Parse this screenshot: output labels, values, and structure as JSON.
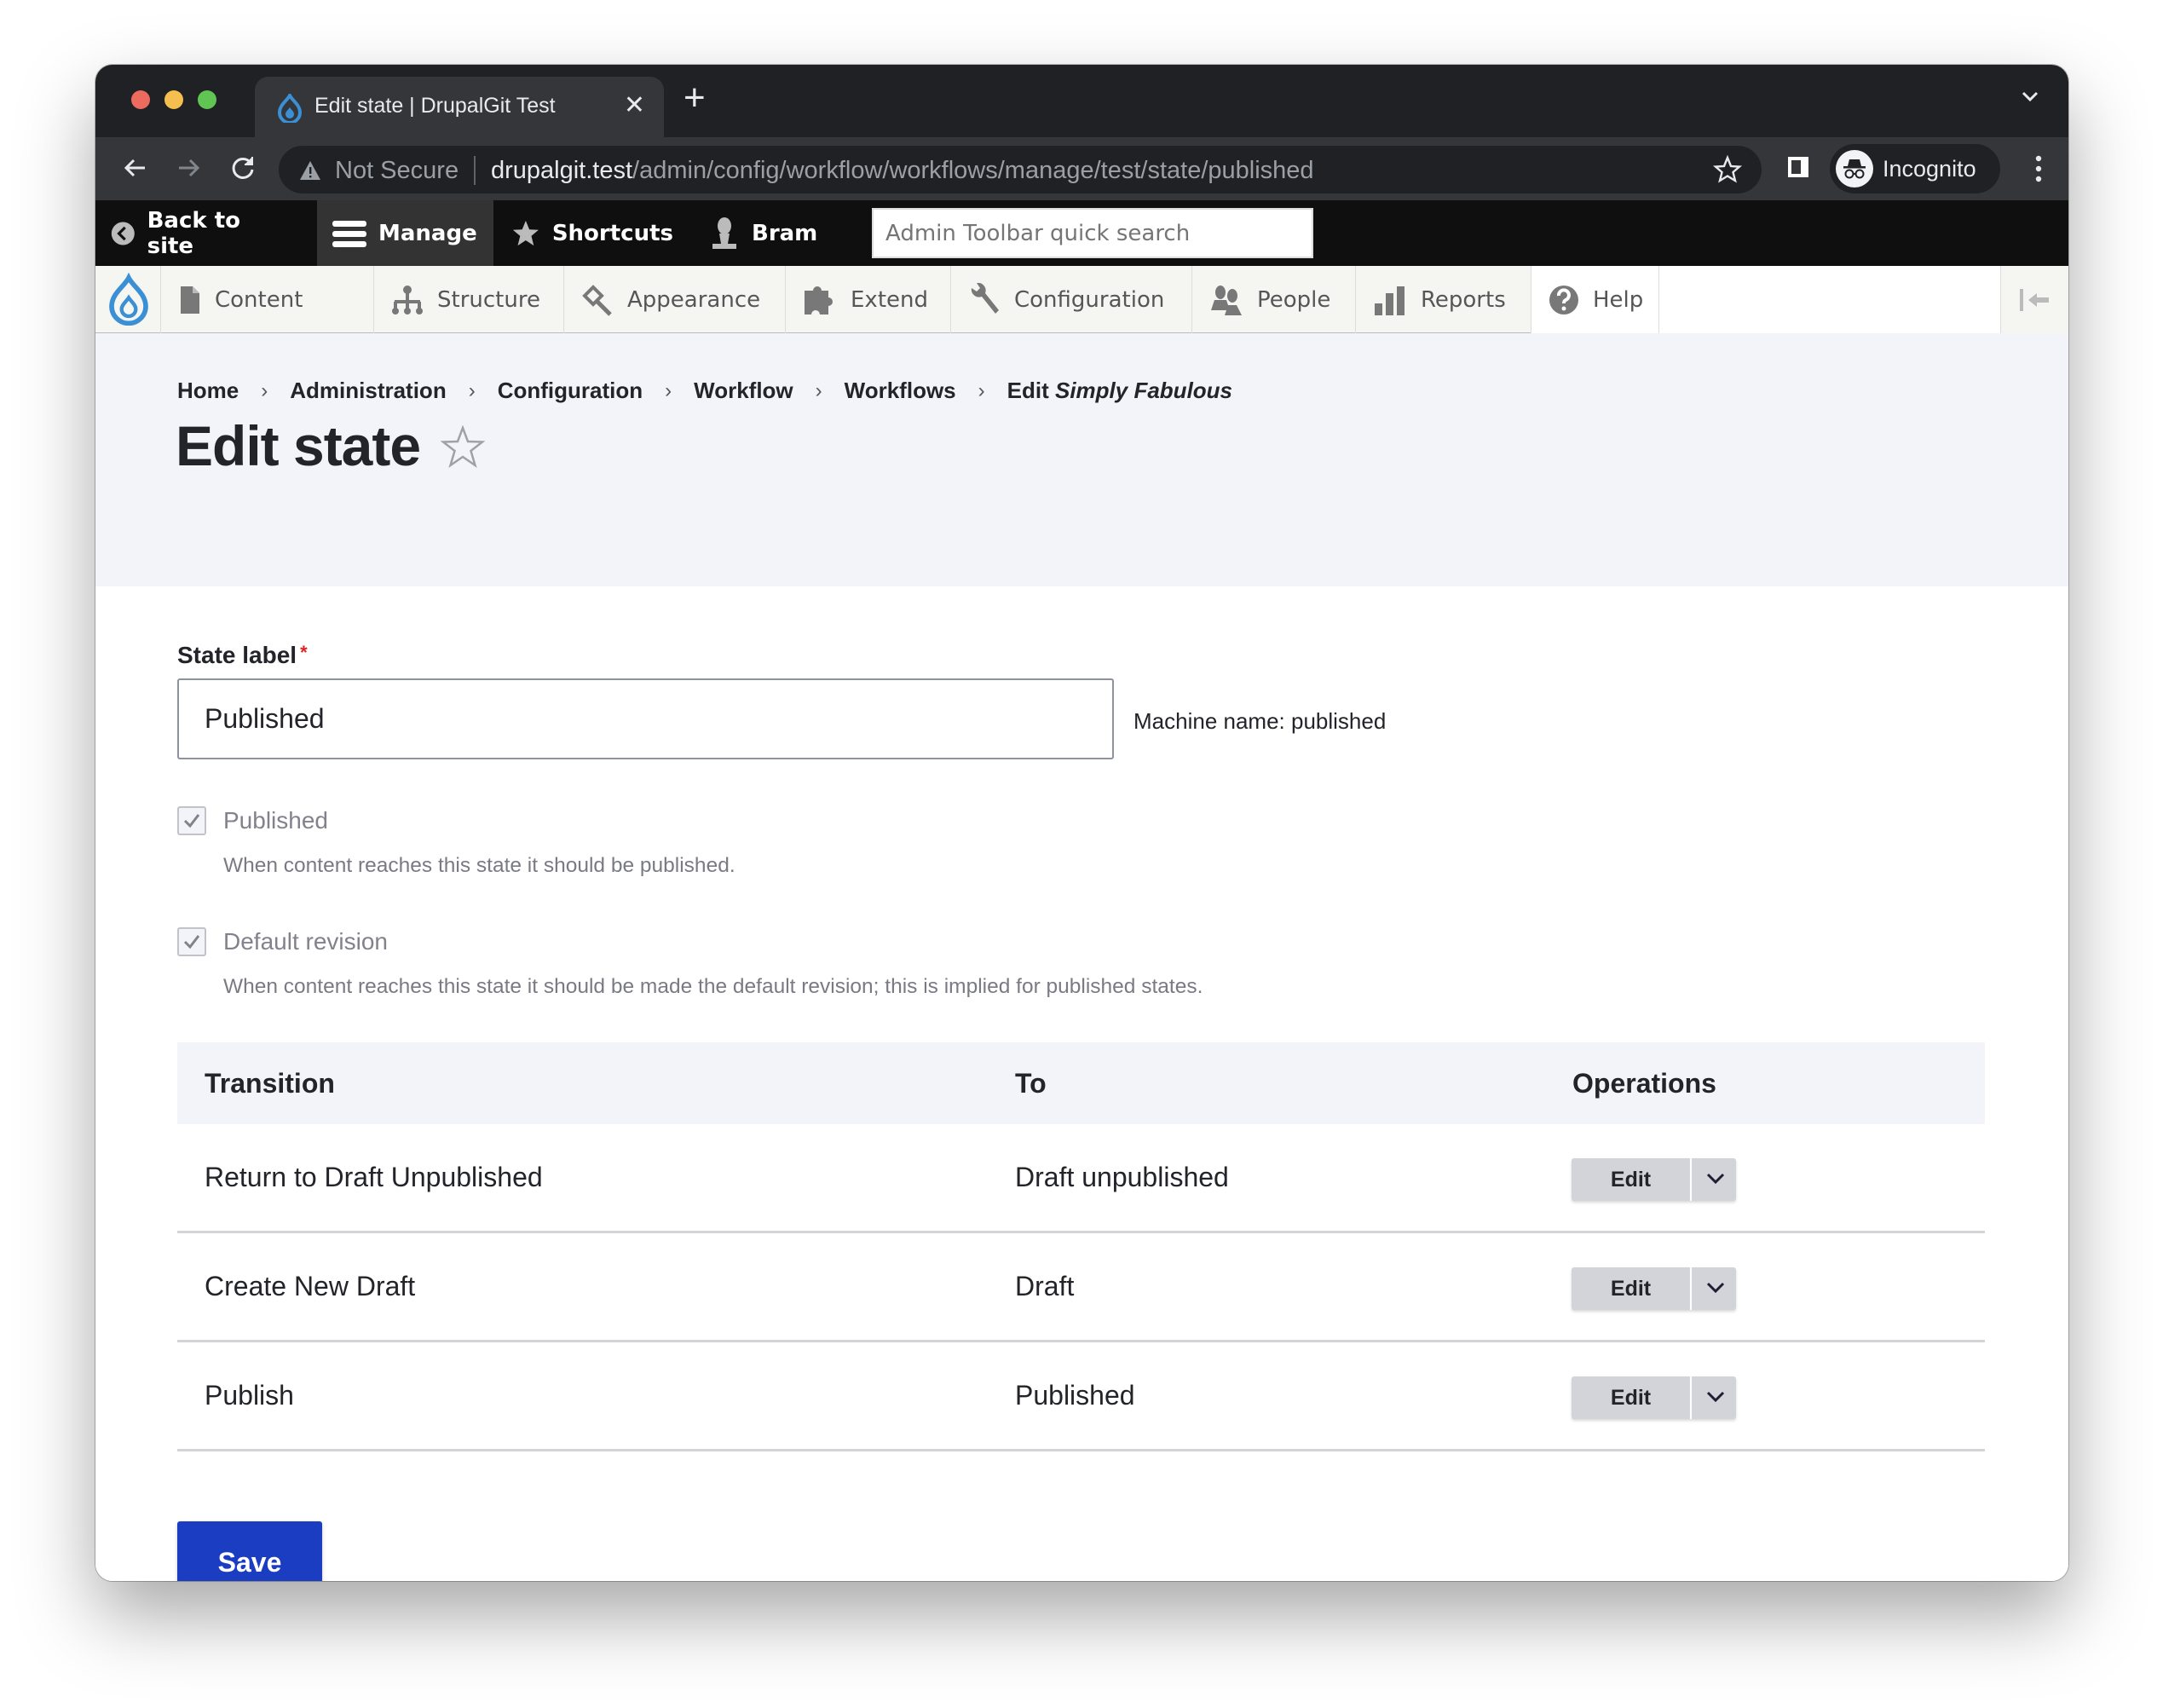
{
  "browser": {
    "tab_title": "Edit state | DrupalGit Test",
    "new_tab_symbol": "+",
    "close_symbol": "✕",
    "security_label": "Not Secure",
    "url_host": "drupalgit.test",
    "url_path": "/admin/config/workflow/workflows/manage/test/state/published",
    "profile_label": "Incognito"
  },
  "admin_toolbar": {
    "back_to_site": "Back to site",
    "manage": "Manage",
    "shortcuts": "Shortcuts",
    "user": "Bram",
    "search_placeholder": "Admin Toolbar quick search"
  },
  "tray": {
    "items": [
      {
        "label": "Content",
        "icon": "file-icon"
      },
      {
        "label": "Structure",
        "icon": "sitemap-icon"
      },
      {
        "label": "Appearance",
        "icon": "paintbrush-icon"
      },
      {
        "label": "Extend",
        "icon": "puzzle-icon"
      },
      {
        "label": "Configuration",
        "icon": "wrench-icon"
      },
      {
        "label": "People",
        "icon": "people-icon"
      },
      {
        "label": "Reports",
        "icon": "bar-chart-icon"
      },
      {
        "label": "Help",
        "icon": "help-icon"
      }
    ]
  },
  "breadcrumb": {
    "items": [
      "Home",
      "Administration",
      "Configuration",
      "Workflow",
      "Workflows"
    ],
    "last_prefix": "Edit",
    "last_emphasis": "Simply Fabulous"
  },
  "page": {
    "title": "Edit state"
  },
  "form": {
    "state_label": "State label",
    "required_marker": "*",
    "state_value": "Published",
    "machine_name": "Machine name: published",
    "published": {
      "label": "Published",
      "checked": true,
      "description": "When content reaches this state it should be published."
    },
    "default_revision": {
      "label": "Default revision",
      "checked": true,
      "description": "When content reaches this state it should be made the default revision; this is implied for published states."
    },
    "save_label": "Save"
  },
  "table": {
    "headers": [
      "Transition",
      "To",
      "Operations"
    ],
    "rows": [
      {
        "transition": "Return to Draft Unpublished",
        "to": "Draft unpublished",
        "operation": "Edit"
      },
      {
        "transition": "Create New Draft",
        "to": "Draft",
        "operation": "Edit"
      },
      {
        "transition": "Publish",
        "to": "Published",
        "operation": "Edit"
      }
    ]
  },
  "colors": {
    "primary_button": "#1b3dc2",
    "drupal_blue": "#3b8fd4",
    "required": "#dc2323"
  }
}
